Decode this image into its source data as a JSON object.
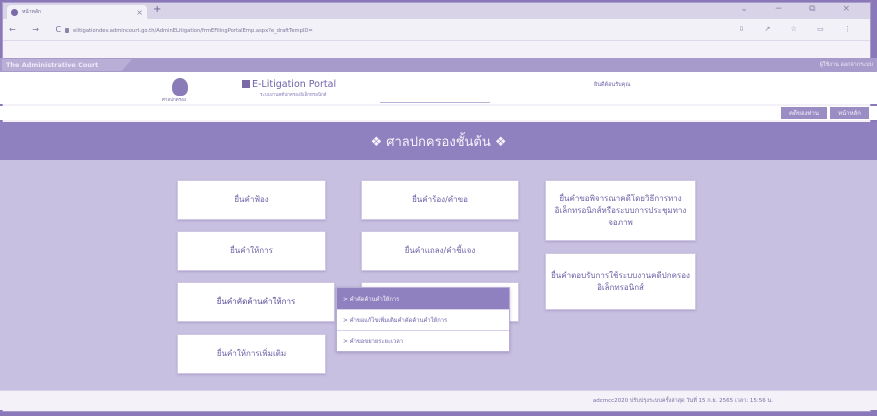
{
  "browser": {
    "tab_title": "หน้าหลัก",
    "tab_close": "×",
    "new_tab": "+",
    "window_controls": "⌄ − ⧉ ×",
    "nav_icons": "← → C",
    "url": "elitigationdev.admincourt.go.th/AdminELitigation/frmEFilingPortalEmp.aspx?e_draftTempID=",
    "bar_icons": "⇩ ↗ ☆ ▭ ⋮"
  },
  "strip": {
    "logo_text": "The Administrative Court",
    "login_text": "ผู้ใช้งาน   ออกจากระบบ"
  },
  "header": {
    "emblem_caption": "ศาลปกครอง",
    "portal_title": "E-Litigation Portal",
    "portal_subtitle": "ระบบงานคดีปกครองอิเล็กทรอนิกส์",
    "welcome": "ยินดีต้อนรับคุณ"
  },
  "tabs": {
    "my_cases": "คดีของท่าน",
    "home": "หน้าหลัก"
  },
  "banner": {
    "title": "❖ ศาลปกครองชั้นต้น ❖"
  },
  "cards": {
    "file_complaint": "ยื่นคำฟ้อง",
    "file_petition": "ยื่นคำร้อง/คำขอ",
    "file_online_hearing": "ยื่นคำขอพิจารณาคดีโดยวิธีการทางอิเล็กทรอนิกส์หรือระบบการประชุมทางจอภาพ",
    "file_testimony": "ยื่นคำให้การ",
    "file_statement": "ยื่นคำแถลง/คำชี้แจง",
    "file_e_service": "ยื่นคำตอบรับการใช้ระบบงานคดีปกครองอิเล็กทรอนิกส์",
    "file_objection": "ยื่นคำคัดค้านคำให้การ",
    "file_additional_testimony": "ยื่นคำให้การเพิ่มเติม"
  },
  "dropdown": {
    "item_1": "> คำคัดค้านคำให้การ",
    "item_2": "> คำขอแก้ไขเพิ่มเติมคำคัดค้านคำให้การ",
    "item_3": "> คำขอขยายระยะเวลา"
  },
  "footer": {
    "text": "adcmcc2020 ปรับปรุงระบบครั้งล่าสุด วันที่ 15 ก.ย. 2565 เวลา: 15:56 น."
  },
  "colors": {
    "accent": "#8f80bf",
    "content_bg": "#c8c0e0",
    "text": "#6e5fa6"
  }
}
